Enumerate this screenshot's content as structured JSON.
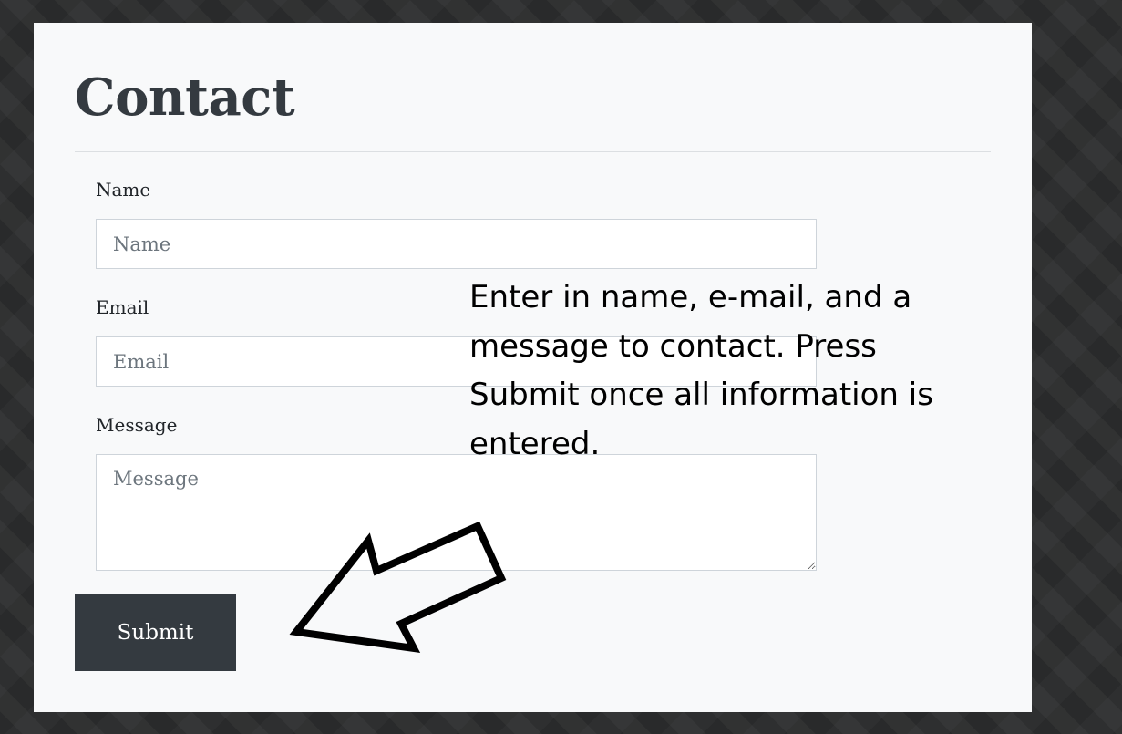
{
  "header": {
    "title": "Contact"
  },
  "form": {
    "name": {
      "label": "Name",
      "placeholder": "Name",
      "value": ""
    },
    "email": {
      "label": "Email",
      "placeholder": "Email",
      "value": ""
    },
    "message": {
      "label": "Message",
      "placeholder": "Message",
      "value": ""
    },
    "submit_label": "Submit"
  },
  "annotation": {
    "text": "Enter in name, e-mail, and a message to contact. Press Submit once all information is entered.",
    "arrow_icon": "arrow-down-left-outline-icon"
  },
  "colors": {
    "page_background": "#2e2f30",
    "card_background": "#f8f9fa",
    "heading": "#343a40",
    "button_background": "#343a40",
    "button_text": "#ffffff"
  }
}
